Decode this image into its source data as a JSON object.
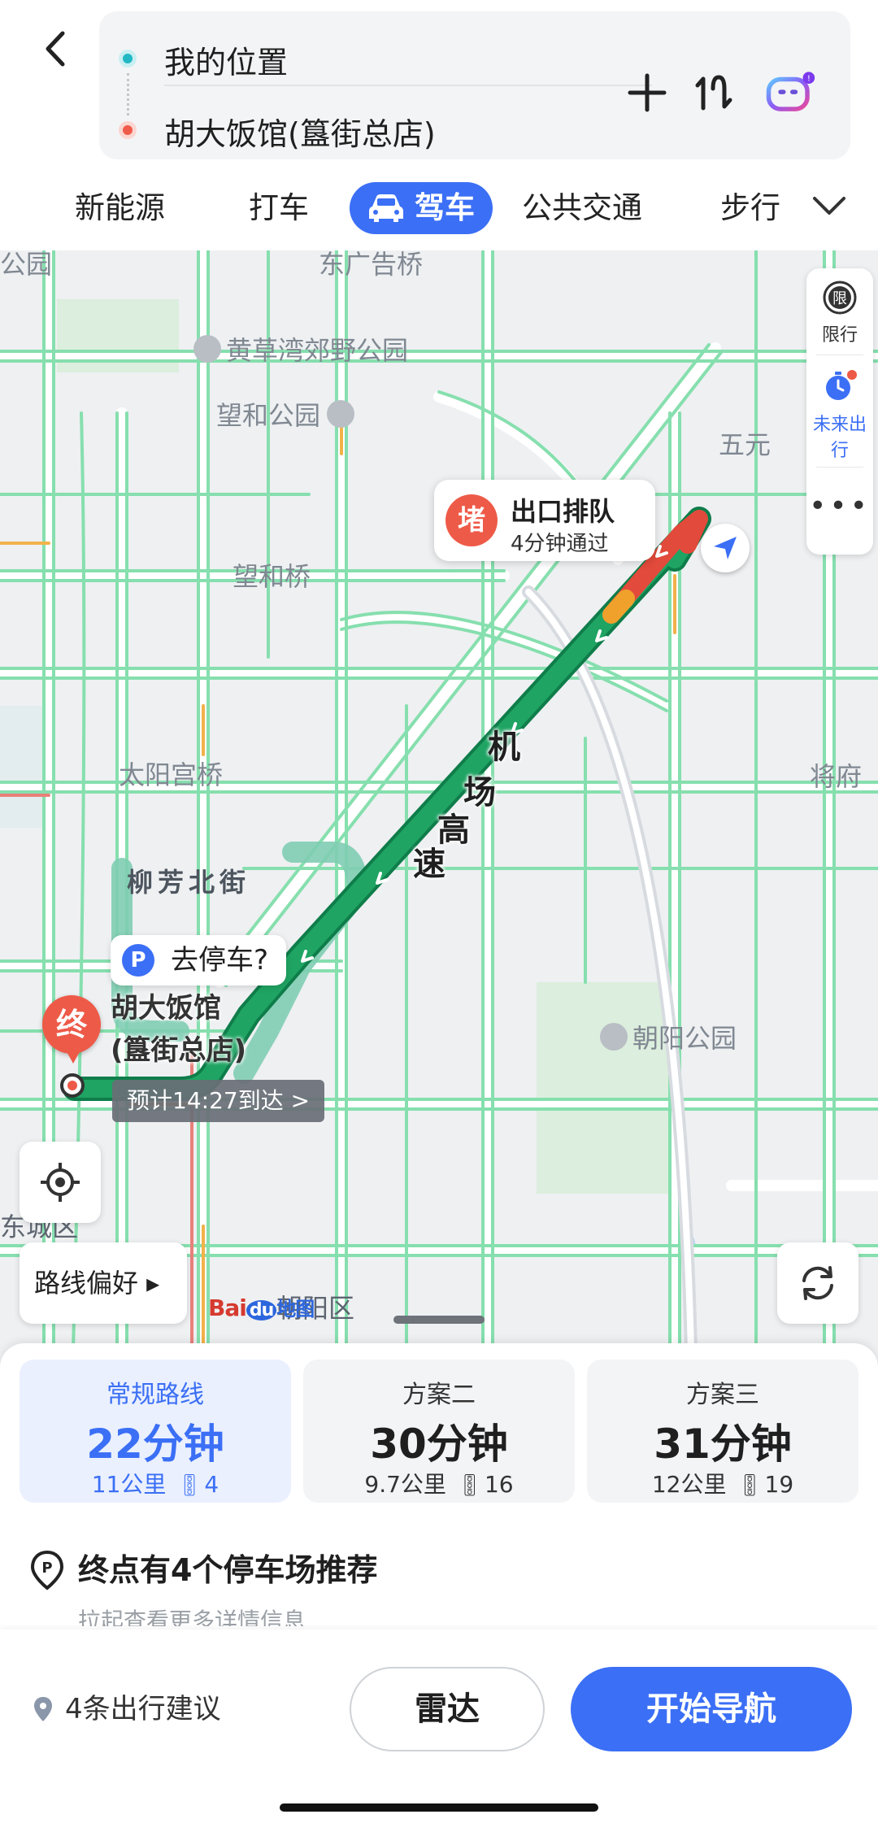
{
  "header": {
    "origin": "我的位置",
    "destination": "胡大饭馆(簋街总店)",
    "modes": [
      "新能源",
      "打车",
      "驾车",
      "公共交通",
      "步行"
    ],
    "active_mode": "驾车"
  },
  "map": {
    "labels": {
      "park1": "黄草湾郊野公园",
      "park2": "望和公园",
      "bridge1": "望和桥",
      "bridge2": "太阳宫桥",
      "street": "柳芳北街",
      "park3": "朝阳公园",
      "district": "东城区",
      "district2": "朝阳区",
      "wuyuan": "五元",
      "jiangfu": "将府",
      "top_cut": "东广告桥",
      "top_left_cut": "公园"
    },
    "side_panel": {
      "limit": "限",
      "limit_label": "限行",
      "future_label": "未来出行",
      "more": "•••"
    },
    "traffic_tip": {
      "badge": "堵",
      "title": "出口排队",
      "subtitle": "4分钟通过"
    },
    "road_name": [
      "机",
      "场",
      "高",
      "速"
    ],
    "parking_tip": {
      "badge": "P",
      "text": "去停车?"
    },
    "end_marker": "终",
    "dest_name_line1": "胡大饭馆",
    "dest_name_line2": "(簋街总店)",
    "eta": "预计14:27到达 >",
    "route_pref": "路线偏好 ▸",
    "logo": {
      "bai": "Bai",
      "du": "du",
      "ditu": "地图"
    }
  },
  "routes": [
    {
      "name": "常规路线",
      "time": "22分钟",
      "distance": "11公里",
      "lights": "4"
    },
    {
      "name": "方案二",
      "time": "30分钟",
      "distance": "9.7公里",
      "lights": "16"
    },
    {
      "name": "方案三",
      "time": "31分钟",
      "distance": "12公里",
      "lights": "19"
    }
  ],
  "parking": {
    "title": "终点有4个停车场推荐",
    "subtitle": "拉起查看更多详情信息"
  },
  "actions": {
    "suggestions": "4条出行建议",
    "radar": "雷达",
    "start": "开始导航"
  },
  "colors": {
    "accent": "#3b6ff5",
    "route_green": "#1fa463",
    "route_shadow": "#7fcdb3",
    "jam_red": "#ee5a48",
    "slow_orange": "#f0a12c",
    "road_green": "#7ddca6",
    "road_white": "#ffffff"
  }
}
